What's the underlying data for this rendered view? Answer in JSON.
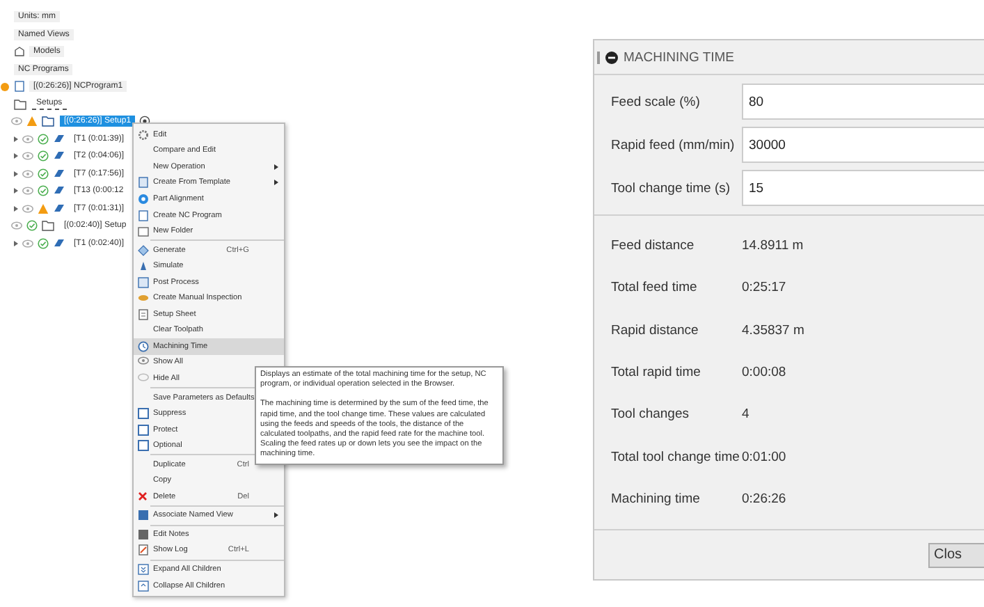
{
  "tree": [
    {
      "label": "Units: mm",
      "kind": "plain"
    },
    {
      "label": "Named Views",
      "kind": "plain"
    },
    {
      "label": "Models",
      "kind": "models"
    },
    {
      "label": "NC Programs",
      "kind": "plain"
    },
    {
      "label": "[(0:26:26)] NCProgram1",
      "kind": "nc-program"
    },
    {
      "label": "Setups",
      "kind": "folder",
      "children": [
        {
          "label": "[(0:26:26)] Setup1",
          "kind": "setup",
          "warning": true,
          "selected": true,
          "children": [
            {
              "label": "[T1 (0:01:39)]",
              "kind": "operation",
              "warning": false,
              "selected": false
            },
            {
              "label": "[T2 (0:04:06)]",
              "kind": "operation",
              "warning": false,
              "selected": false
            },
            {
              "label": "[T7 (0:17:56)]",
              "kind": "operation",
              "warning": false,
              "selected": false
            },
            {
              "label": "[T13 (0:00:12",
              "kind": "operation",
              "warning": false,
              "selected": false
            },
            {
              "label": "[T7 (0:01:31)]",
              "kind": "operation",
              "warning": true,
              "selected": false
            }
          ]
        },
        {
          "label": "[(0:02:40)] Setup",
          "kind": "setup",
          "warning": false,
          "selected": false,
          "children": [
            {
              "label": "[T1 (0:02:40)]",
              "kind": "operation",
              "warning": false,
              "selected": false
            }
          ]
        }
      ]
    }
  ],
  "menu": [
    {
      "kind": "item",
      "label": "Edit",
      "selected": false
    },
    {
      "kind": "item",
      "label": "Compare and Edit",
      "selected": false
    },
    {
      "kind": "item",
      "label": "New Operation",
      "submenu": true,
      "selected": false
    },
    {
      "kind": "item",
      "label": "Create From Template",
      "submenu": true,
      "selected": false
    },
    {
      "kind": "item",
      "label": "Part Alignment",
      "selected": false
    },
    {
      "kind": "item",
      "label": "Create NC Program",
      "selected": false
    },
    {
      "kind": "item",
      "label": "New Folder",
      "selected": false
    },
    {
      "kind": "divider"
    },
    {
      "kind": "item",
      "label": "Generate",
      "shortcut": "Ctrl+G",
      "selected": false
    },
    {
      "kind": "item",
      "label": "Simulate",
      "selected": false
    },
    {
      "kind": "item",
      "label": "Post Process",
      "selected": false
    },
    {
      "kind": "item",
      "label": "Create Manual Inspection",
      "selected": false
    },
    {
      "kind": "item",
      "label": "Setup Sheet",
      "selected": false
    },
    {
      "kind": "item",
      "label": "Clear Toolpath",
      "selected": false
    },
    {
      "kind": "item",
      "label": "Machining Time",
      "selected": true
    },
    {
      "kind": "item",
      "label": "Show All",
      "selected": false
    },
    {
      "kind": "item",
      "label": "Hide All",
      "selected": false
    },
    {
      "kind": "divider"
    },
    {
      "kind": "item",
      "label": "Save Parameters as Defaults",
      "selected": false
    },
    {
      "kind": "checkbox",
      "label": "Suppress",
      "checked": false,
      "selected": false
    },
    {
      "kind": "checkbox",
      "label": "Protect",
      "checked": false,
      "selected": false
    },
    {
      "kind": "checkbox",
      "label": "Optional",
      "checked": false,
      "selected": false
    },
    {
      "kind": "divider"
    },
    {
      "kind": "item",
      "label": "Duplicate",
      "shortcut": "Ctrl",
      "selected": false
    },
    {
      "kind": "item",
      "label": "Copy",
      "selected": false
    },
    {
      "kind": "item",
      "label": "Delete",
      "shortcut": "Del",
      "selected": false
    },
    {
      "kind": "divider"
    },
    {
      "kind": "item",
      "label": "Associate Named View",
      "submenu": true,
      "selected": false
    },
    {
      "kind": "divider"
    },
    {
      "kind": "item",
      "label": "Edit Notes",
      "selected": false
    },
    {
      "kind": "item",
      "label": "Show Log",
      "shortcut": "Ctrl+L",
      "selected": false
    },
    {
      "kind": "divider"
    },
    {
      "kind": "item",
      "label": "Expand All Children",
      "selected": false
    },
    {
      "kind": "item",
      "label": "Collapse All Children",
      "selected": false
    }
  ],
  "tooltip": [
    "Displays an estimate of the total machining time for the setup, NC program, or individual operation selected in the Browser.",
    "The machining time is determined by the sum of the feed time, the rapid time, and the tool change time. These values are calculated using the feeds and speeds of the tools, the distance of the calculated toolpaths, and the rapid feed rate for the machine tool. Scaling the feed rates up or down lets you see the impact on the machining time."
  ],
  "dialog": {
    "title": "MACHINING TIME",
    "inputs": [
      {
        "label": "Feed scale (%)",
        "value": "80"
      },
      {
        "label": "Rapid feed (mm/min)",
        "value": "30000"
      },
      {
        "label": "Tool change time (s)",
        "value": "15"
      }
    ],
    "results": [
      {
        "label": "Feed distance",
        "value": "14.8911 m"
      },
      {
        "label": "Total feed time",
        "value": "0:25:17"
      },
      {
        "label": "Rapid distance",
        "value": "4.35837 m"
      },
      {
        "label": "Total rapid time",
        "value": "0:00:08"
      },
      {
        "label": "Tool changes",
        "value": "4"
      },
      {
        "label": "Total tool change time",
        "value": "0:01:00"
      },
      {
        "label": "Machining time",
        "value": "0:26:26"
      }
    ],
    "buttons": [
      "Clos"
    ]
  }
}
